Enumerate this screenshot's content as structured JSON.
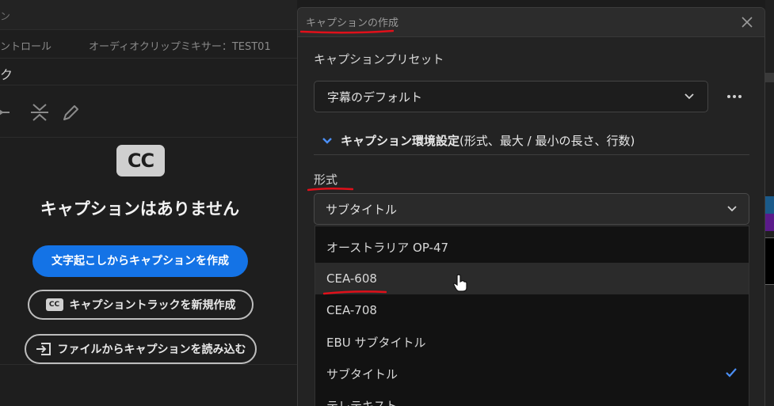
{
  "background": {
    "top_fragment": "ン",
    "tab_control": "ントロール",
    "tab_mixer": "オーディオクリップミキサー：TEST01",
    "track_header": "ク",
    "cc_logo": "CC",
    "no_captions": "キャプションはありません",
    "btn_transcribe": "文字起こしからキャプションを作成",
    "btn_new_track_icon": "CC",
    "btn_new_track": "キャプショントラックを新規作成",
    "btn_import": "ファイルからキャプションを読み込む"
  },
  "dialog": {
    "title": "キャプションの作成",
    "preset_label": "キャプションプリセット",
    "preset_value": "字幕のデフォルト",
    "section_title_bold": "キャプション環境設定",
    "section_title_rest": " (形式、最大 / 最小の長さ、行数)",
    "format_label": "形式",
    "format_value": "サブタイトル",
    "format_options": [
      "オーストラリア OP-47",
      "CEA-608",
      "CEA-708",
      "EBU サブタイトル",
      "サブタイトル",
      "テレテキスト"
    ],
    "selected_option": "サブタイトル",
    "hovered_option": "CEA-608"
  },
  "colors": {
    "accent_blue": "#1473e6",
    "annotation_red": "#e0101a",
    "check_blue": "#4b8ff5"
  }
}
